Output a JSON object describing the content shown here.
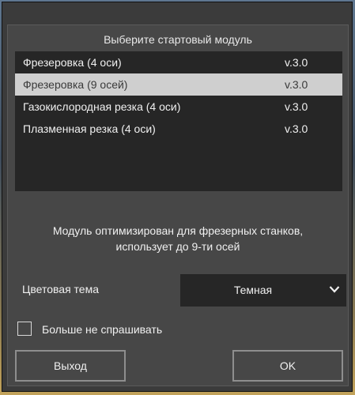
{
  "dialog": {
    "title": "Выберите стартовый модуль"
  },
  "modules": [
    {
      "name": "Фрезеровка (4 оси)",
      "version": "v.3.0",
      "selected": false
    },
    {
      "name": "Фрезеровка (9 осей)",
      "version": "v.3.0",
      "selected": true
    },
    {
      "name": "Газокислородная резка (4 оси)",
      "version": "v.3.0",
      "selected": false
    },
    {
      "name": "Плазменная резка (4 оси)",
      "version": "v.3.0",
      "selected": false
    }
  ],
  "description": {
    "line1": "Модуль оптимизирован для фрезерных станков,",
    "line2": "использует до 9-ти осей"
  },
  "theme": {
    "label": "Цветовая тема",
    "value": "Темная"
  },
  "dont_ask": {
    "label": "Больше не спрашивать",
    "checked": false
  },
  "buttons": {
    "exit": "Выход",
    "ok": "OK"
  },
  "colors": {
    "window_bg": "#3b3b3b",
    "panel_bg": "#474747",
    "list_bg": "#262626",
    "selected_row": "#cfcfcf",
    "text": "#f0f0f0"
  },
  "icons": {
    "dropdown": "chevron-down-icon"
  }
}
